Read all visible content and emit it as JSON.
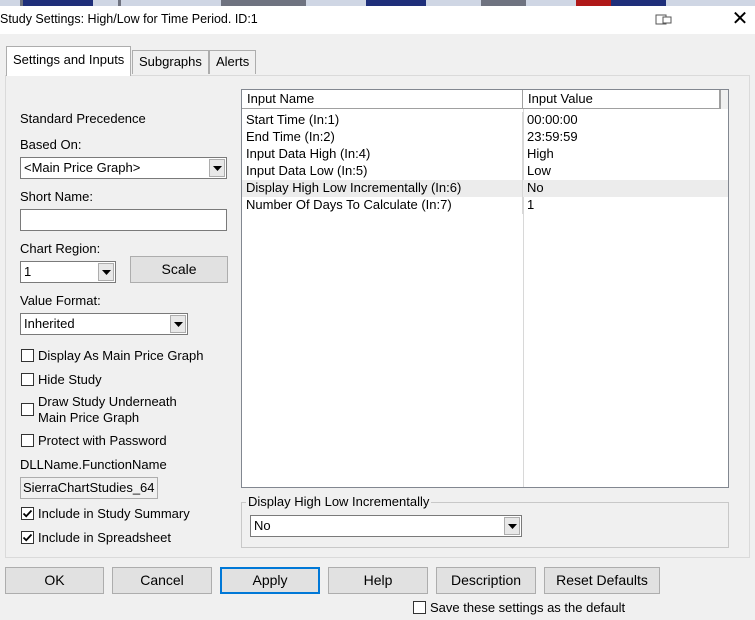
{
  "window": {
    "title": "Study Settings: High/Low for Time Period. ID:1",
    "close_glyph": "✕",
    "icons": [
      "restore-icon",
      "close-icon"
    ]
  },
  "tabs": [
    {
      "label": "Settings and Inputs",
      "active": true
    },
    {
      "label": "Subgraphs",
      "active": false
    },
    {
      "label": "Alerts",
      "active": false
    }
  ],
  "left": {
    "standard_precedence": "Standard Precedence",
    "based_on_label": "Based On:",
    "based_on_value": "<Main Price Graph>",
    "short_name_label": "Short Name:",
    "short_name_value": "",
    "chart_region_label": "Chart Region:",
    "chart_region_value": "1",
    "scale_button": "Scale",
    "value_format_label": "Value Format:",
    "value_format_value": "Inherited",
    "display_main_price": "Display As Main Price Graph",
    "hide_study": "Hide Study",
    "draw_underneath_1": "Draw Study Underneath",
    "draw_underneath_2": "Main Price Graph",
    "protect_password": "Protect with Password",
    "dll_label": "DLLName.FunctionName",
    "dll_value": "SierraChartStudies_64",
    "include_summary": "Include in Study Summary",
    "include_spreadsheet": "Include in Spreadsheet",
    "checks": {
      "display_main_price": false,
      "hide_study": false,
      "draw_underneath": false,
      "protect_password": false,
      "include_summary": true,
      "include_spreadsheet": true
    }
  },
  "grid": {
    "col_name": "Input Name",
    "col_value": "Input Value",
    "rows": [
      {
        "name": "Start Time  (In:1)",
        "value": "00:00:00"
      },
      {
        "name": "End Time  (In:2)",
        "value": "23:59:59"
      },
      {
        "name": "Input Data High  (In:4)",
        "value": "High"
      },
      {
        "name": "Input Data Low  (In:5)",
        "value": "Low"
      },
      {
        "name": "Display High Low Incrementally  (In:6)",
        "value": "No",
        "selected": true
      },
      {
        "name": "Number Of Days To Calculate  (In:7)",
        "value": "1"
      }
    ]
  },
  "editor": {
    "label": "Display High Low Incrementally",
    "value": "No"
  },
  "buttons": {
    "ok": "OK",
    "cancel": "Cancel",
    "apply": "Apply",
    "help": "Help",
    "description": "Description",
    "reset_defaults": "Reset Defaults"
  },
  "save_default": {
    "label": "Save these settings as the default",
    "checked": false
  },
  "colors": {
    "accent": "#0078d7",
    "strip_navy": "#1f2f7a",
    "strip_red": "#b01818",
    "strip_gray": "#6f7380"
  }
}
